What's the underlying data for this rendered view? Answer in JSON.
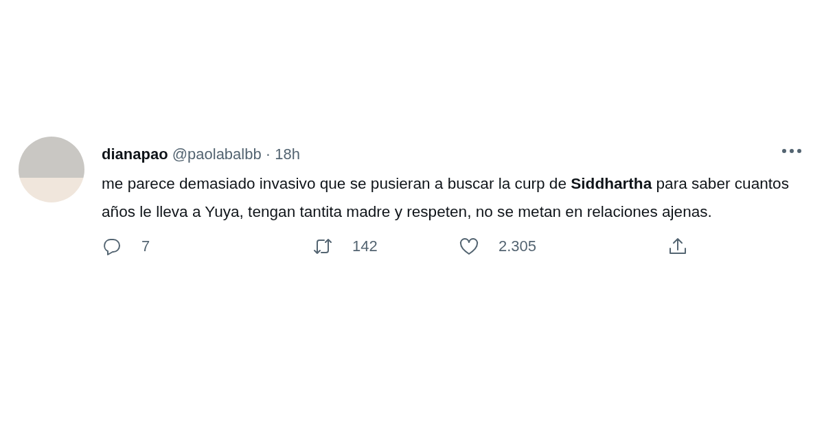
{
  "tweet": {
    "display_name": "dianapao",
    "handle": "@paolabalbb",
    "separator": "·",
    "time": "18h",
    "text": "me parece demasiado invasivo que se pusieran a buscar la curp de **Siddhartha** para saber cuantos años le lleva a Yuya, tengan tantita madre y respeten, no se metan en relaciones ajenas.",
    "actions": [
      {
        "kind": "reply",
        "count": "7"
      },
      {
        "kind": "retweet",
        "count": "142"
      },
      {
        "kind": "like",
        "count": "2.305"
      },
      {
        "kind": "share"
      }
    ]
  }
}
